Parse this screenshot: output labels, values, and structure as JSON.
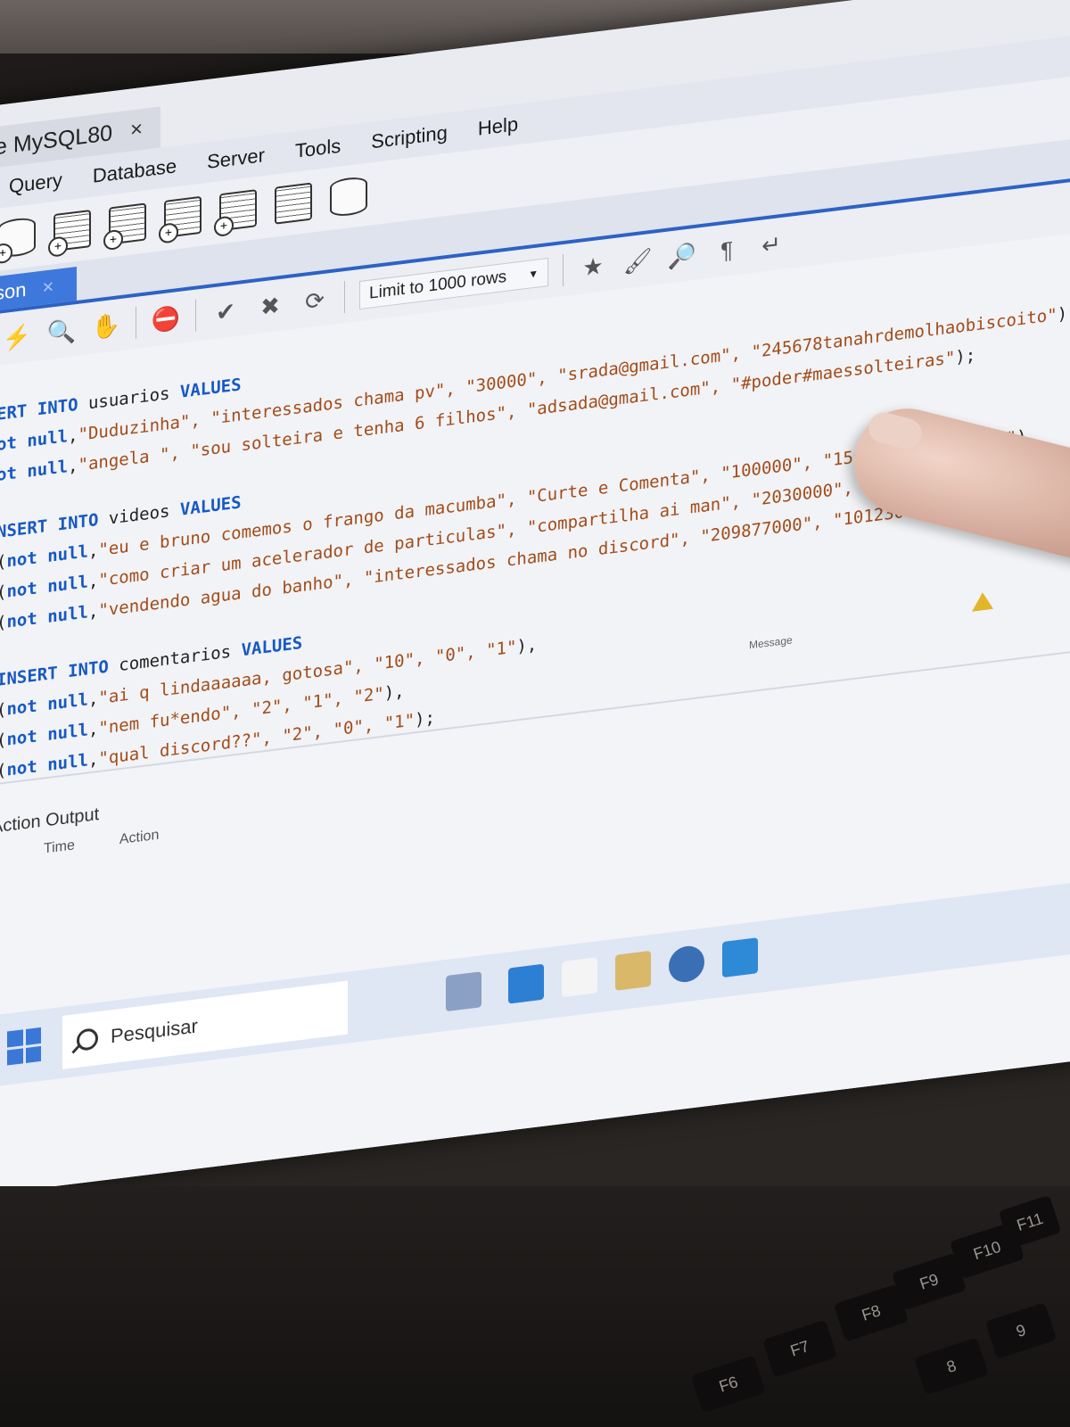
{
  "window": {
    "connection_tab": "e MySQL80",
    "close_glyph": "×"
  },
  "menu": [
    "Query",
    "Database",
    "Server",
    "Tools",
    "Scripting",
    "Help"
  ],
  "editor": {
    "tab_label": "son",
    "tab_close": "×",
    "limit_label": "Limit to 1000 rows"
  },
  "code_lines": [
    [
      {
        "t": "kw",
        "v": "ERT INTO "
      },
      {
        "t": "id",
        "v": "usuarios "
      },
      {
        "t": "kw",
        "v": "VALUES"
      }
    ],
    [
      {
        "t": "kw",
        "v": "ot null"
      },
      {
        "t": "pn",
        "v": ","
      },
      {
        "t": "str",
        "v": "\"Duduzinha\", \"interessados chama pv\", \"30000\", \"srada@gmail.com\", \"245678tanahrdemolhaobiscoito\""
      },
      {
        "t": "pn",
        "v": "),"
      }
    ],
    [
      {
        "t": "kw",
        "v": "ot null"
      },
      {
        "t": "pn",
        "v": ","
      },
      {
        "t": "str",
        "v": "\"angela \", \"sou solteira e tenha 6 filhos\", \"adsada@gmail.com\", \"#poder#maessolteiras\""
      },
      {
        "t": "pn",
        "v": ");"
      }
    ],
    [],
    [
      {
        "t": "kw",
        "v": "NSERT INTO "
      },
      {
        "t": "id",
        "v": "videos "
      },
      {
        "t": "kw",
        "v": "VALUES"
      }
    ],
    [
      {
        "t": "pn",
        "v": "("
      },
      {
        "t": "kw",
        "v": "not null"
      },
      {
        "t": "pn",
        "v": ","
      },
      {
        "t": "str",
        "v": "\"eu e bruno comemos o frango da macumba\", \"Curte e Comenta\", \"100000\", \"1500\", \"2000\", \"1\""
      },
      {
        "t": "pn",
        "v": "),"
      }
    ],
    [
      {
        "t": "pn",
        "v": "("
      },
      {
        "t": "kw",
        "v": "not null"
      },
      {
        "t": "pn",
        "v": ","
      },
      {
        "t": "str",
        "v": "\"como criar um acelerador de particulas\", \"compartilha ai man\", \"2030000\", \"1000220\", \"10\", \"2\""
      },
      {
        "t": "pn",
        "v": "),"
      }
    ],
    [
      {
        "t": "pn",
        "v": "("
      },
      {
        "t": "kw",
        "v": "not null"
      },
      {
        "t": "pn",
        "v": ","
      },
      {
        "t": "str",
        "v": "\"vendendo agua do banho\", \"interessados chama no discord\", \"209877000\", \"1012300\", \"23\", \"1\""
      },
      {
        "t": "pn",
        "v": ");"
      }
    ],
    [],
    [
      {
        "t": "kw",
        "v": "INSERT INTO "
      },
      {
        "t": "id",
        "v": "comentarios "
      },
      {
        "t": "kw",
        "v": "VALUES"
      }
    ],
    [
      {
        "t": "pn",
        "v": "("
      },
      {
        "t": "kw",
        "v": "not null"
      },
      {
        "t": "pn",
        "v": ","
      },
      {
        "t": "str",
        "v": "\"ai q lindaaaaaa, gotosa\", \"10\", \"0\", \"1\""
      },
      {
        "t": "pn",
        "v": "),"
      }
    ],
    [
      {
        "t": "pn",
        "v": "("
      },
      {
        "t": "kw",
        "v": "not null"
      },
      {
        "t": "pn",
        "v": ","
      },
      {
        "t": "str",
        "v": "\"nem fu*endo\", \"2\", \"1\", \"2\""
      },
      {
        "t": "pn",
        "v": "),"
      }
    ],
    [
      {
        "t": "pn",
        "v": "("
      },
      {
        "t": "kw",
        "v": "not null"
      },
      {
        "t": "pn",
        "v": ","
      },
      {
        "t": "str",
        "v": "\"qual discord??\", \"2\", \"0\", \"1\""
      },
      {
        "t": "pn",
        "v": ");"
      }
    ]
  ],
  "output": {
    "label": "Action Output",
    "columns": [
      "#",
      "Time",
      "Action"
    ],
    "message_col": "Message"
  },
  "taskbar": {
    "search_label": "Pesquisar"
  },
  "keyboard": [
    "F6",
    "F7",
    "F8",
    "F9",
    "F10",
    "F11",
    "8",
    "9"
  ],
  "colors": {
    "keyword": "#1659c4",
    "string": "#a24c1a",
    "accent_tab": "#3f78dc"
  }
}
